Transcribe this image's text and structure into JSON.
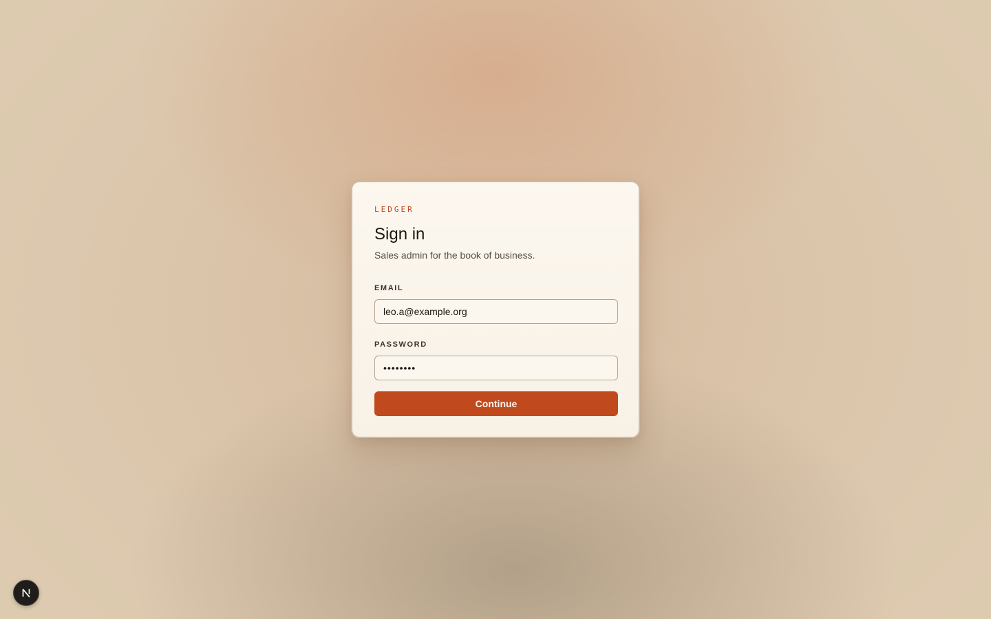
{
  "brand": {
    "name": "LEDGER"
  },
  "signin": {
    "title": "Sign in",
    "subtitle": "Sales admin for the book of business.",
    "email": {
      "label": "EMAIL",
      "value": "leo.a@example.org"
    },
    "password": {
      "label": "PASSWORD",
      "value": "password"
    },
    "submit_label": "Continue"
  },
  "dev_badge": {
    "icon": "nextjs-logo-icon",
    "letter": "N"
  },
  "colors": {
    "accent": "#c04a1d",
    "card_bg": "#fcf7ef",
    "text_primary": "#1e1712"
  }
}
